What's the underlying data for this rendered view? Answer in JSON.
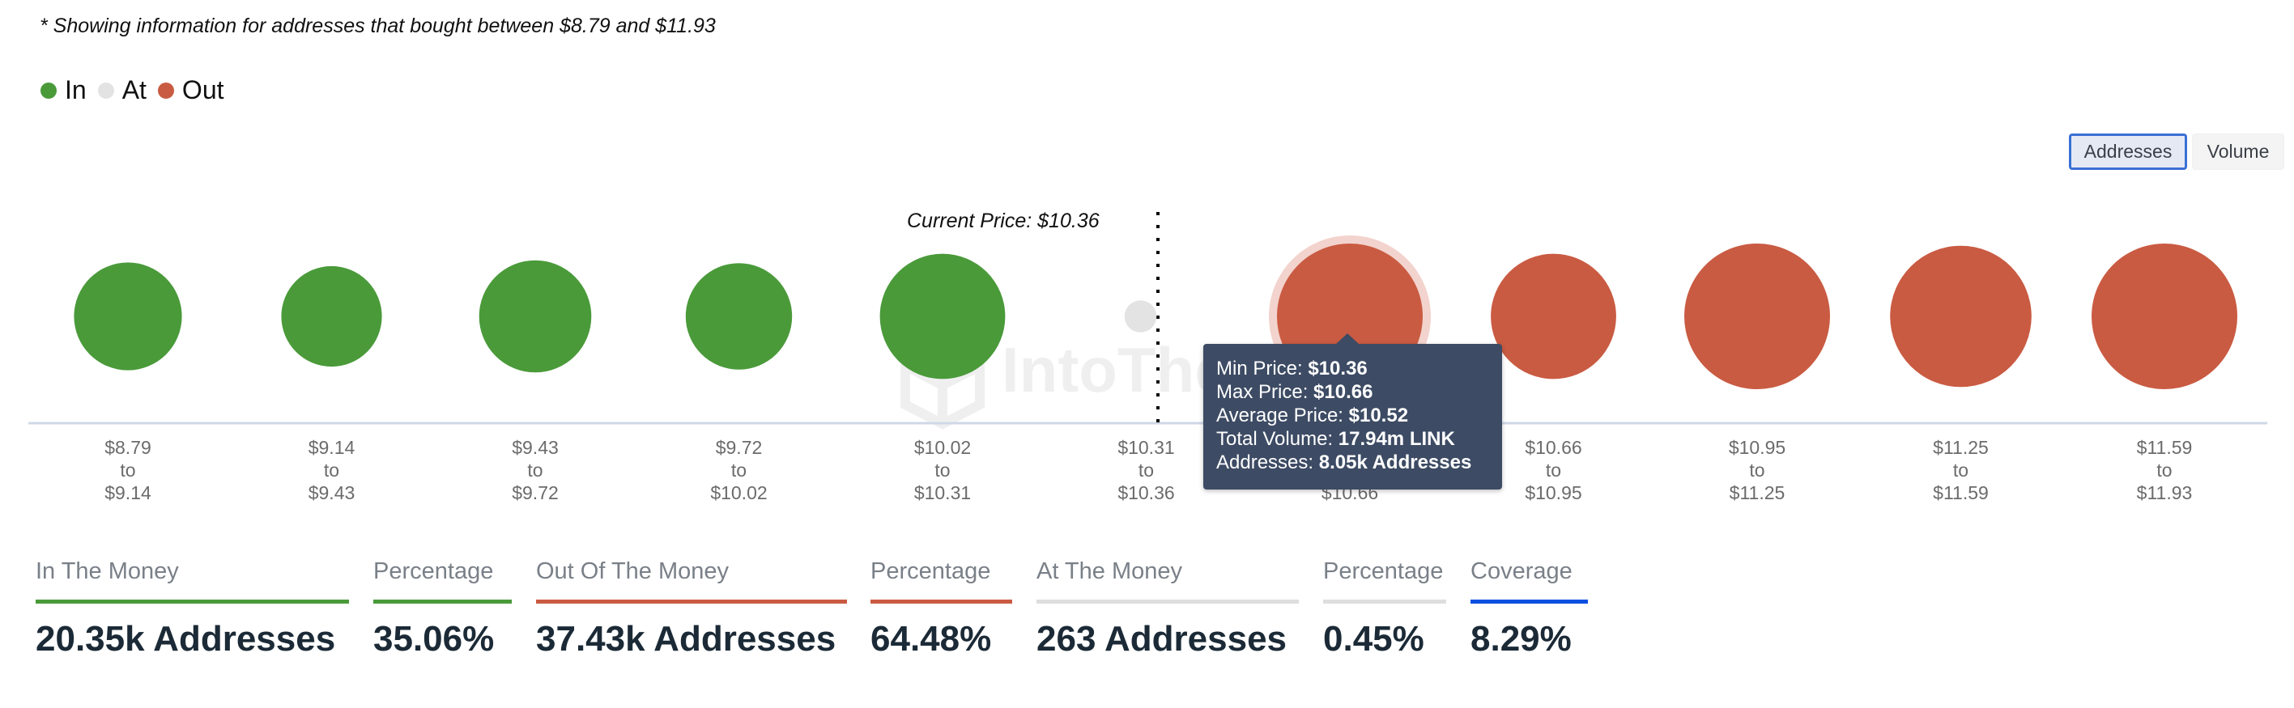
{
  "caption": "* Showing information for addresses that bought between $8.79 and $11.93",
  "legend": [
    {
      "label": "In",
      "color": "#4a9a3a"
    },
    {
      "label": "At",
      "color": "#e3e3e3"
    },
    {
      "label": "Out",
      "color": "#c95b42"
    }
  ],
  "toggle": {
    "addresses_label": "Addresses",
    "volume_label": "Volume",
    "selected": "Addresses"
  },
  "watermark": "IntoTheBlock",
  "tooltip": {
    "min_price_label": "Min Price: ",
    "min_price": "$10.36",
    "max_price_label": "Max Price: ",
    "max_price": "$10.66",
    "avg_price_label": "Average Price: ",
    "avg_price": "$10.52",
    "volume_label": "Total Volume: ",
    "volume": "17.94m LINK",
    "addresses_label": "Addresses: ",
    "addresses": "8.05k Addresses"
  },
  "chart_data": {
    "type": "bubble",
    "title": "",
    "current_price_label": "Current Price: $10.36",
    "current_price": 10.36,
    "size_metric": "Addresses",
    "colors": {
      "in": "#4a9a3a",
      "at": "#e3e3e3",
      "out": "#c95b42",
      "hover_halo": "#f3d3cd"
    },
    "highlighted_index": 6,
    "buckets": [
      {
        "from": "$8.79",
        "to": "$9.14",
        "status": "in",
        "relative_size": 0.74
      },
      {
        "from": "$9.14",
        "to": "$9.43",
        "status": "in",
        "relative_size": 0.69
      },
      {
        "from": "$9.43",
        "to": "$9.72",
        "status": "in",
        "relative_size": 0.77
      },
      {
        "from": "$9.72",
        "to": "$10.02",
        "status": "in",
        "relative_size": 0.73
      },
      {
        "from": "$10.02",
        "to": "$10.31",
        "status": "in",
        "relative_size": 0.86
      },
      {
        "from": "$10.31",
        "to": "$10.36",
        "status": "at",
        "relative_size": 0.22
      },
      {
        "from": "$10.36",
        "to": "$10.66",
        "status": "out",
        "relative_size": 1.0
      },
      {
        "from": "$10.66",
        "to": "$10.95",
        "status": "out",
        "relative_size": 0.86
      },
      {
        "from": "$10.95",
        "to": "$11.25",
        "status": "out",
        "relative_size": 1.0
      },
      {
        "from": "$11.25",
        "to": "$11.59",
        "status": "out",
        "relative_size": 0.97
      },
      {
        "from": "$11.59",
        "to": "$11.93",
        "status": "out",
        "relative_size": 1.0
      }
    ],
    "to_word": "to"
  },
  "stats": [
    {
      "label": "In The Money",
      "value": "20.35k Addresses",
      "color": "#4a9a3a"
    },
    {
      "label": "Percentage",
      "value": "35.06%",
      "color": "#4a9a3a"
    },
    {
      "label": "Out Of The Money",
      "value": "37.43k Addresses",
      "color": "#c95b42"
    },
    {
      "label": "Percentage",
      "value": "64.48%",
      "color": "#c95b42"
    },
    {
      "label": "At The Money",
      "value": "263 Addresses",
      "color": "#dedede"
    },
    {
      "label": "Percentage",
      "value": "0.45%",
      "color": "#dedede"
    },
    {
      "label": "Coverage",
      "value": "8.29%",
      "color": "#0a4fe0"
    }
  ]
}
